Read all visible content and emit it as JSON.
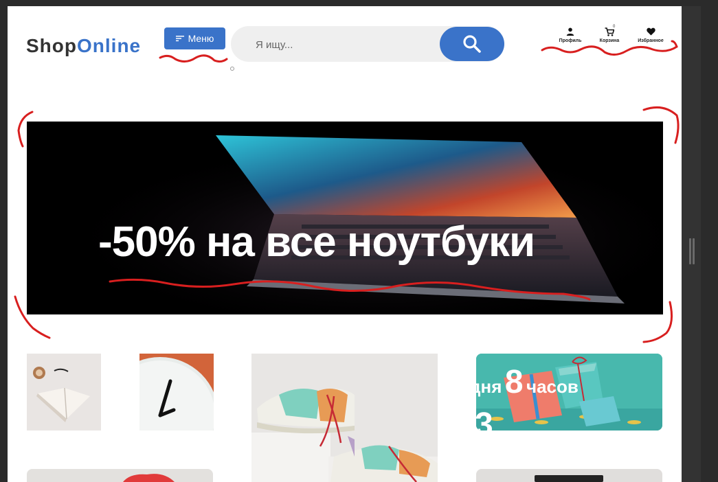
{
  "header": {
    "logo_part1": "Shop",
    "logo_part2": "Online",
    "menu_label": "Меню",
    "search_placeholder": "Я ищу...",
    "icons": [
      {
        "label": "Профиль",
        "icon": "person-icon"
      },
      {
        "label": "Корзина",
        "icon": "cart-icon",
        "count": "0"
      },
      {
        "label": "Избранное",
        "icon": "heart-icon"
      }
    ]
  },
  "banner": {
    "text": "-50% на все ноутбуки"
  },
  "promo": {
    "countdown_days_fragment": "дня",
    "countdown_hours_value": "8",
    "countdown_hours_label": "часов",
    "countdown_second_value": "3"
  },
  "colors": {
    "brand_blue": "#3a73c9",
    "logo_dark": "#333333",
    "annotation_red": "#d81f1f"
  }
}
